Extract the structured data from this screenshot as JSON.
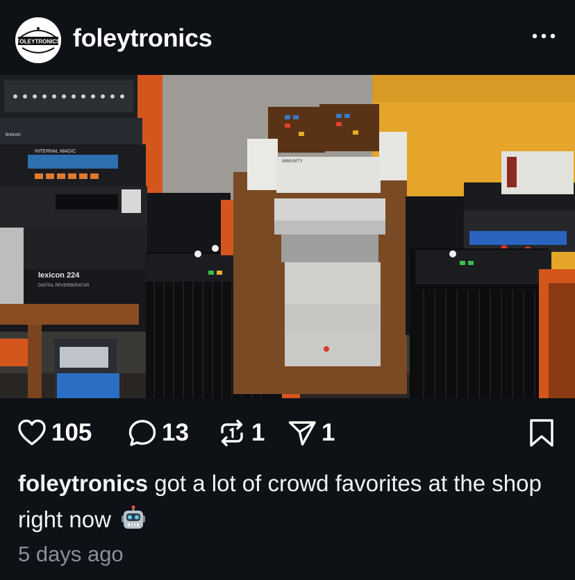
{
  "post": {
    "username": "foleytronics",
    "avatar_text": "FOLEYTRONICS",
    "more_icon": "more-horizontal-icon",
    "photo_text": {
      "top_unit": "IMMUNITY",
      "lexicon": "lexicon",
      "lexicon_224": "lexicon 224",
      "digital_reverb": "DIGITAL REVERBERATOR",
      "internal_magic": "INTERNAL MAGIC"
    },
    "actions": {
      "likes": "105",
      "comments": "13",
      "reposts": "1",
      "shares": "1"
    },
    "caption": {
      "username": "foleytronics",
      "text": "got a lot of crowd favorites at the shop right now",
      "emoji": "robot-emoji"
    },
    "timestamp": "5 days ago"
  },
  "colors": {
    "background": "#0e1116",
    "text": "#f2f3f5",
    "muted": "#8b9097",
    "accent_orange": "#d4561c",
    "wall_yellow": "#e4a52a"
  }
}
